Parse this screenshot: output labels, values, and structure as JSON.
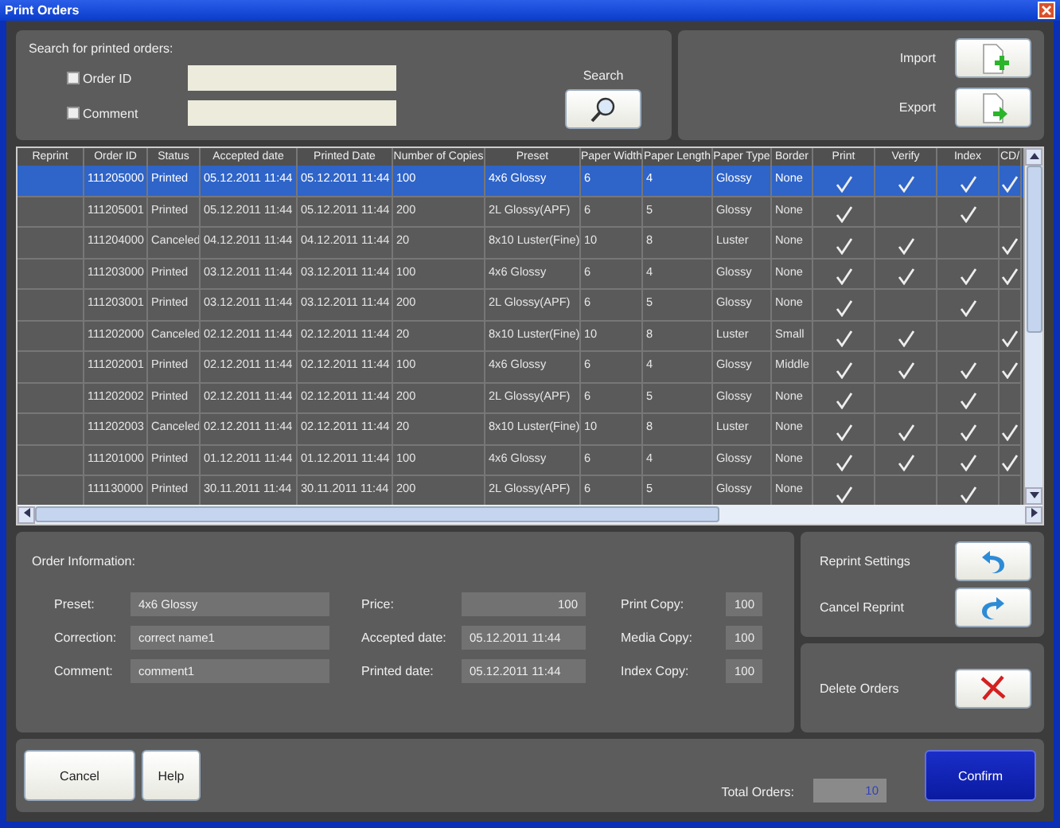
{
  "window": {
    "title": "Print Orders"
  },
  "search": {
    "heading": "Search for printed orders:",
    "fields": [
      {
        "label": "Order ID",
        "checked": false
      },
      {
        "label": "Comment",
        "checked": false
      }
    ],
    "button": "Search"
  },
  "transfer": [
    {
      "label": "Import",
      "kind": "import"
    },
    {
      "label": "Export",
      "kind": "export"
    }
  ],
  "table": {
    "columns": [
      "Reprint",
      "Order ID",
      "Status",
      "Accepted date",
      "Printed Date",
      "Number of Copies",
      "Preset",
      "Paper Width",
      "Paper Length",
      "Paper Type",
      "Border",
      "Print",
      "Verify",
      "Index",
      "CD/"
    ],
    "rows": [
      {
        "selected": true,
        "cells": [
          "",
          "111205000",
          "Printed",
          "05.12.2011 11:44",
          "05.12.2011 11:44",
          "100",
          "4x6 Glossy",
          "6",
          "4",
          "Glossy",
          "None"
        ],
        "checks": [
          true,
          true,
          true,
          true
        ]
      },
      {
        "selected": false,
        "cells": [
          "",
          "111205001",
          "Printed",
          "05.12.2011 11:44",
          "05.12.2011 11:44",
          "200",
          "2L Glossy(APF)",
          "6",
          "5",
          "Glossy",
          "None"
        ],
        "checks": [
          true,
          false,
          true,
          false
        ]
      },
      {
        "selected": false,
        "cells": [
          "",
          "111204000",
          "Canceled",
          "04.12.2011 11:44",
          "04.12.2011 11:44",
          "20",
          "8x10 Luster(Fine)",
          "10",
          "8",
          "Luster",
          "None"
        ],
        "checks": [
          true,
          true,
          false,
          true
        ]
      },
      {
        "selected": false,
        "cells": [
          "",
          "111203000",
          "Printed",
          "03.12.2011 11:44",
          "03.12.2011 11:44",
          "100",
          "4x6 Glossy",
          "6",
          "4",
          "Glossy",
          "None"
        ],
        "checks": [
          true,
          true,
          true,
          true
        ]
      },
      {
        "selected": false,
        "cells": [
          "",
          "111203001",
          "Printed",
          "03.12.2011 11:44",
          "03.12.2011 11:44",
          "200",
          "2L Glossy(APF)",
          "6",
          "5",
          "Glossy",
          "None"
        ],
        "checks": [
          true,
          false,
          true,
          false
        ]
      },
      {
        "selected": false,
        "cells": [
          "",
          "111202000",
          "Canceled",
          "02.12.2011 11:44",
          "02.12.2011 11:44",
          "20",
          "8x10 Luster(Fine)",
          "10",
          "8",
          "Luster",
          "Small"
        ],
        "checks": [
          true,
          true,
          false,
          true
        ]
      },
      {
        "selected": false,
        "cells": [
          "",
          "111202001",
          "Printed",
          "02.12.2011 11:44",
          "02.12.2011 11:44",
          "100",
          "4x6 Glossy",
          "6",
          "4",
          "Glossy",
          "Middle"
        ],
        "checks": [
          true,
          true,
          true,
          true
        ]
      },
      {
        "selected": false,
        "cells": [
          "",
          "111202002",
          "Printed",
          "02.12.2011 11:44",
          "02.12.2011 11:44",
          "200",
          "2L Glossy(APF)",
          "6",
          "5",
          "Glossy",
          "None"
        ],
        "checks": [
          true,
          false,
          true,
          false
        ]
      },
      {
        "selected": false,
        "cells": [
          "",
          "111202003",
          "Canceled",
          "02.12.2011 11:44",
          "02.12.2011 11:44",
          "20",
          "8x10 Luster(Fine)",
          "10",
          "8",
          "Luster",
          "None"
        ],
        "checks": [
          true,
          true,
          true,
          true
        ]
      },
      {
        "selected": false,
        "cells": [
          "",
          "111201000",
          "Printed",
          "01.12.2011 11:44",
          "01.12.2011 11:44",
          "100",
          "4x6 Glossy",
          "6",
          "4",
          "Glossy",
          "None"
        ],
        "checks": [
          true,
          true,
          true,
          true
        ]
      },
      {
        "selected": false,
        "cells": [
          "",
          "111130000",
          "Printed",
          "30.11.2011 11:44",
          "30.11.2011 11:44",
          "200",
          "2L Glossy(APF)",
          "6",
          "5",
          "Glossy",
          "None"
        ],
        "checks": [
          true,
          false,
          true,
          false
        ]
      }
    ]
  },
  "order_info": {
    "heading": "Order Information:",
    "fields": [
      {
        "label": "Preset:",
        "value": "4x6 Glossy",
        "kind": "wide"
      },
      {
        "label": "Price:",
        "value": "100",
        "kind": "number"
      },
      {
        "label": "Print Copy:",
        "value": "100",
        "kind": "short"
      },
      {
        "label": "Correction:",
        "value": "correct name1",
        "kind": "wide"
      },
      {
        "label": "Accepted date:",
        "value": "05.12.2011 11:44",
        "kind": "text"
      },
      {
        "label": "Media Copy:",
        "value": "100",
        "kind": "short"
      },
      {
        "label": "Comment:",
        "value": "comment1",
        "kind": "wide"
      },
      {
        "label": "Printed date:",
        "value": "05.12.2011 11:44",
        "kind": "text"
      },
      {
        "label": "Index Copy:",
        "value": "100",
        "kind": "short"
      }
    ]
  },
  "reprint_actions": [
    {
      "label": "Reprint Settings",
      "kind": "undo"
    },
    {
      "label": "Cancel Reprint",
      "kind": "redo"
    }
  ],
  "delete_action": {
    "label": "Delete Orders",
    "kind": "delete"
  },
  "footer": {
    "buttons": [
      "Cancel",
      "Help"
    ],
    "total_label": "Total Orders:",
    "total_value": "10",
    "confirm": "Confirm"
  }
}
